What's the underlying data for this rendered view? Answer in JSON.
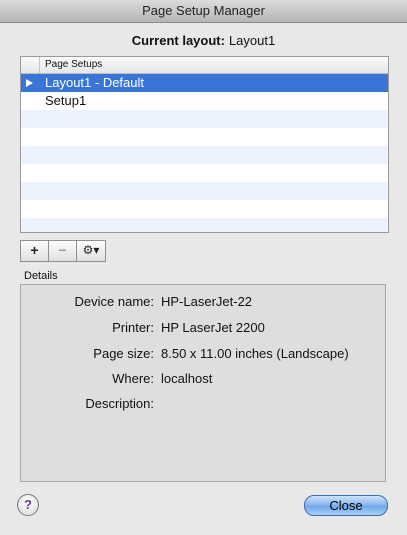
{
  "window": {
    "title": "Page Setup Manager"
  },
  "current_layout": {
    "label": "Current layout:",
    "value": "Layout1"
  },
  "list": {
    "header": "Page Setups",
    "items": [
      {
        "label": "Layout1 - Default"
      },
      {
        "label": "Setup1"
      }
    ]
  },
  "toolbar": {
    "add_label": "+",
    "remove_label": "−",
    "gear_icon": "gear-icon"
  },
  "details": {
    "section_label": "Details",
    "fields": [
      {
        "label": "Device name:",
        "value": "HP-LaserJet-22"
      },
      {
        "label": "Printer:",
        "value": "HP LaserJet 2200"
      },
      {
        "label": "Page size:",
        "value": "8.50 x 11.00 inches (Landscape)"
      },
      {
        "label": "Where:",
        "value": "localhost"
      },
      {
        "label": "Description:",
        "value": ""
      }
    ]
  },
  "buttons": {
    "help_label": "?",
    "close_label": "Close"
  },
  "colors": {
    "selection": "#3875d7",
    "alt_row": "#edf3fe",
    "close_button": "#84b4ec"
  }
}
